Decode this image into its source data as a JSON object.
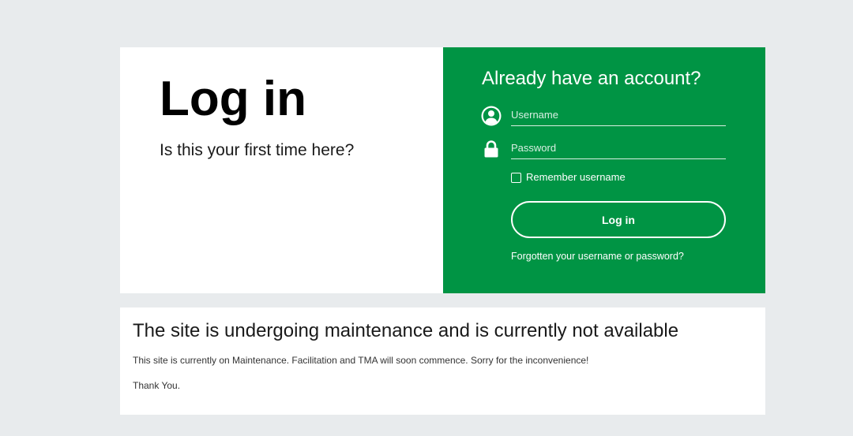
{
  "login": {
    "title": "Log in",
    "first_time": "Is this your first time here?"
  },
  "account": {
    "heading": "Already have an account?",
    "username_placeholder": "Username",
    "password_placeholder": "Password",
    "remember_label": "Remember username",
    "remember_checked": false,
    "login_button": "Log in",
    "forgot_link": "Forgotten your username or password?",
    "user_icon": "user-icon",
    "lock_icon": "lock-icon"
  },
  "notice": {
    "title": "The site is undergoing maintenance and is currently not available",
    "body": "This site is currently on Maintenance. Facilitation and TMA will soon commence. Sorry for the inconvenience!",
    "thanks": "Thank You."
  },
  "colors": {
    "accent_green": "#009444",
    "page_background": "#e8ebed"
  }
}
